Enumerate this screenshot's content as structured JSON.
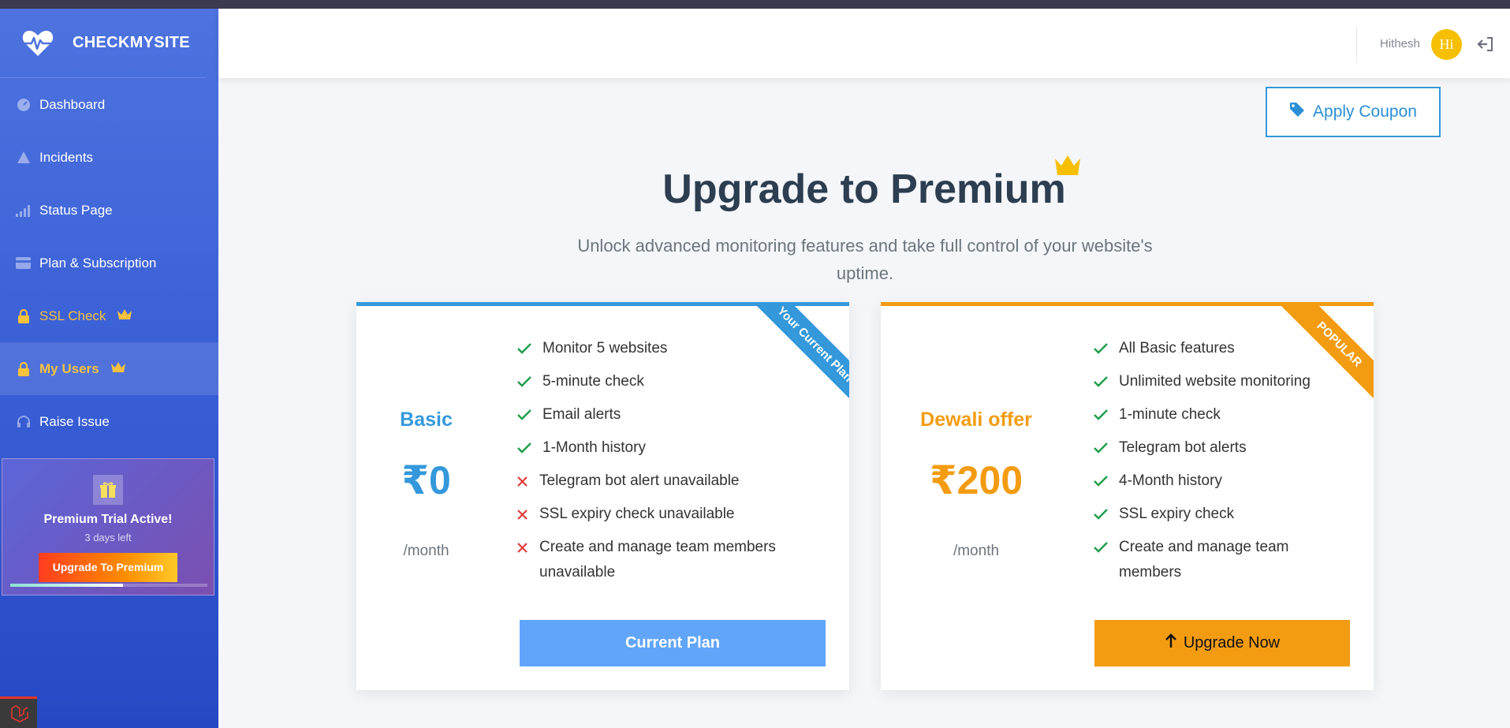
{
  "brand": {
    "name": "CHECKMYSITE",
    "icon": "heartbeat-icon"
  },
  "sidebar": {
    "items": [
      {
        "label": "Dashboard",
        "icon": "gauge-icon"
      },
      {
        "label": "Incidents",
        "icon": "warning-icon"
      },
      {
        "label": "Status Page",
        "icon": "signal-bars-icon"
      },
      {
        "label": "Plan & Subscription",
        "icon": "credit-card-icon"
      },
      {
        "label": "SSL Check",
        "icon": "lock-icon",
        "premium": true
      },
      {
        "label": "My Users",
        "icon": "lock-icon",
        "premium": true,
        "active": true
      },
      {
        "label": "Raise Issue",
        "icon": "headset-icon"
      }
    ],
    "trial": {
      "title": "Premium Trial Active!",
      "days_left": "3 days left",
      "button": "Upgrade To Premium",
      "progress": 0.57
    }
  },
  "header": {
    "user_name": "Hithesh",
    "avatar_initials": "Hi"
  },
  "coupon": {
    "label": "Apply Coupon"
  },
  "hero": {
    "title": "Upgrade to Premium",
    "subtitle": "Unlock advanced monitoring features and take full control of your website's uptime."
  },
  "plans": [
    {
      "ribbon": "Your Current Plan",
      "name": "Basic",
      "price": "₹0",
      "per": "/month",
      "features": [
        {
          "text": "Monitor 5 websites",
          "included": true
        },
        {
          "text": "5-minute check",
          "included": true
        },
        {
          "text": "Email alerts",
          "included": true
        },
        {
          "text": "1-Month history",
          "included": true
        },
        {
          "text": "Telegram bot alert unavailable",
          "included": false
        },
        {
          "text": "SSL expiry check unavailable",
          "included": false
        },
        {
          "text": "Create and manage team members unavailable",
          "included": false
        }
      ],
      "button": "Current Plan"
    },
    {
      "ribbon": "POPULAR",
      "name": "Dewali offer",
      "price": "₹200",
      "per": "/month",
      "features": [
        {
          "text": "All Basic features",
          "included": true
        },
        {
          "text": "Unlimited website monitoring",
          "included": true
        },
        {
          "text": "1-minute check",
          "included": true
        },
        {
          "text": "Telegram bot alerts",
          "included": true
        },
        {
          "text": "4-Month history",
          "included": true
        },
        {
          "text": "SSL expiry check",
          "included": true
        },
        {
          "text": "Create and manage team members",
          "included": true
        }
      ],
      "button": "Upgrade Now"
    }
  ],
  "colors": {
    "sidebar": "#4e73df",
    "basic": "#3498db",
    "premium": "#f39c12",
    "gold": "#f6c23e"
  }
}
